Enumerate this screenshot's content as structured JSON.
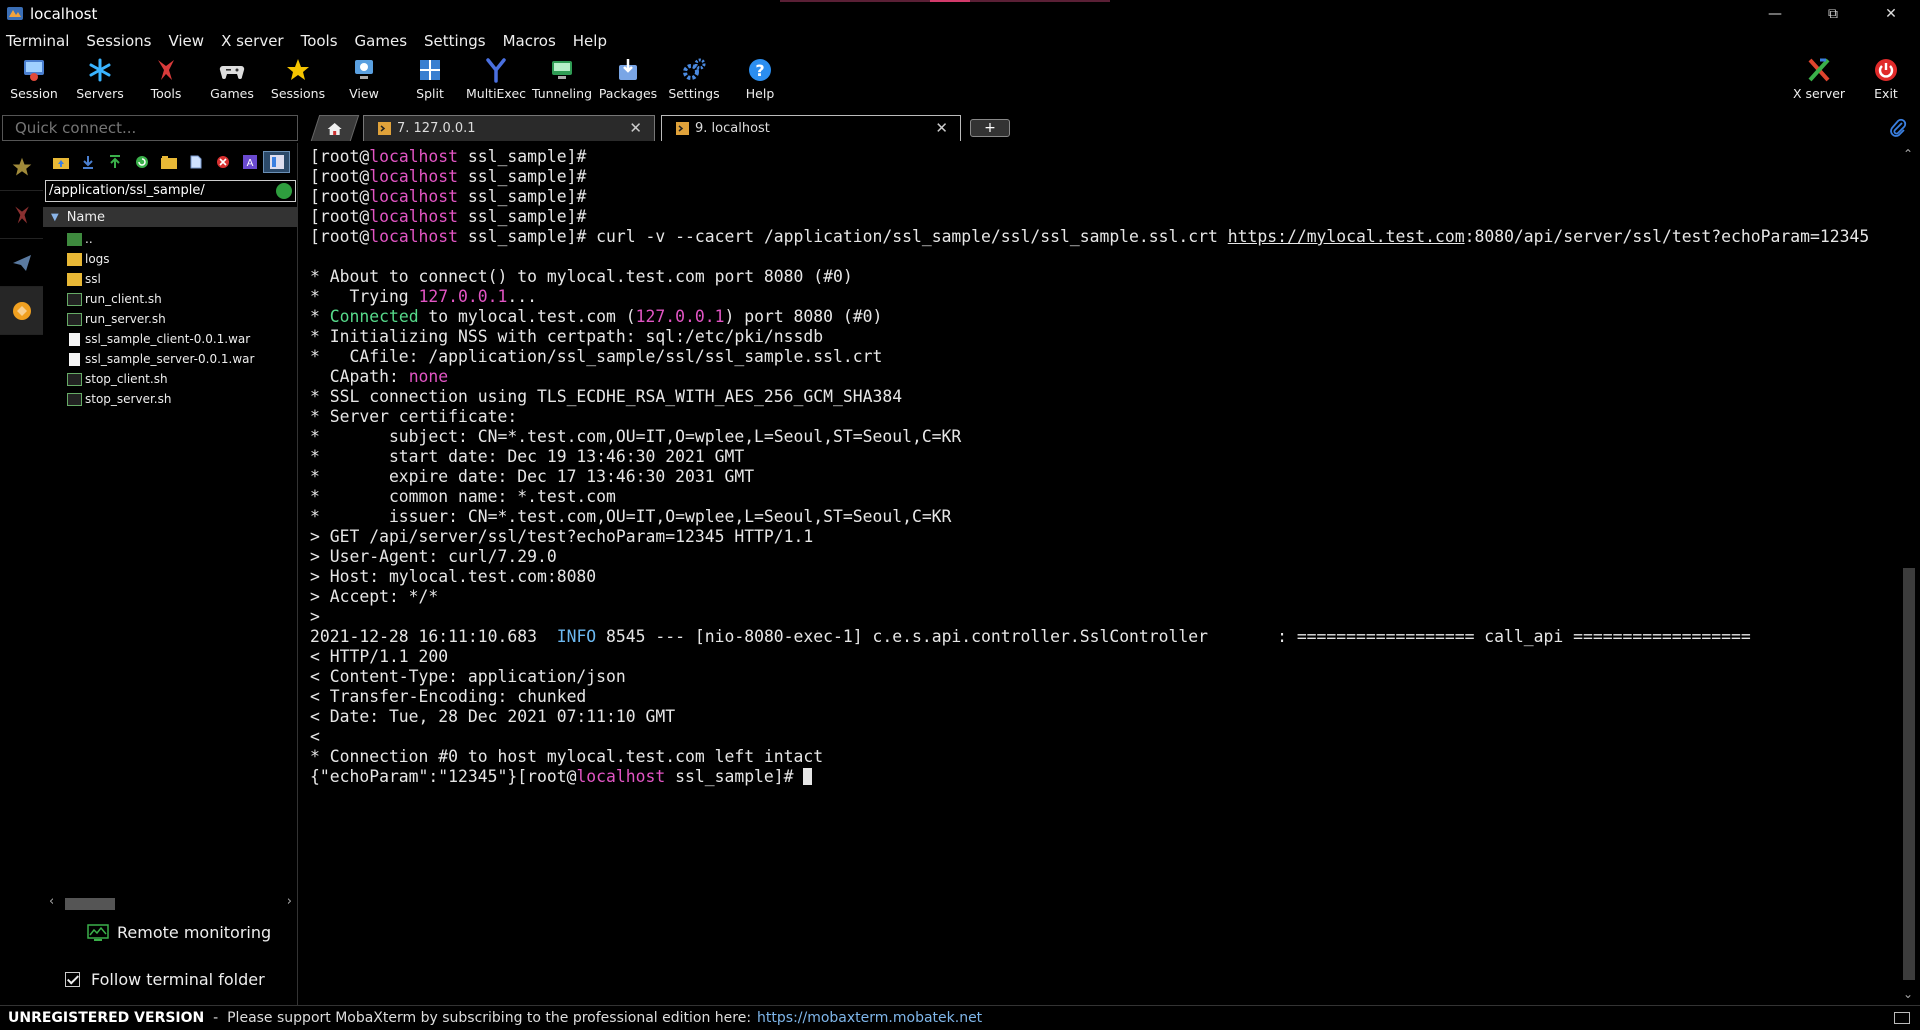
{
  "window": {
    "title": "localhost"
  },
  "menu": [
    "Terminal",
    "Sessions",
    "View",
    "X server",
    "Tools",
    "Games",
    "Settings",
    "Macros",
    "Help"
  ],
  "toolbar": {
    "buttons": [
      {
        "label": "Session",
        "icon": "session-icon"
      },
      {
        "label": "Servers",
        "icon": "servers-icon"
      },
      {
        "label": "Tools",
        "icon": "tools-icon"
      },
      {
        "label": "Games",
        "icon": "games-icon"
      },
      {
        "label": "Sessions",
        "icon": "star-icon"
      },
      {
        "label": "View",
        "icon": "view-icon"
      },
      {
        "label": "Split",
        "icon": "split-icon"
      },
      {
        "label": "MultiExec",
        "icon": "multiexec-icon"
      },
      {
        "label": "Tunneling",
        "icon": "tunneling-icon"
      },
      {
        "label": "Packages",
        "icon": "packages-icon"
      },
      {
        "label": "Settings",
        "icon": "settings-icon"
      },
      {
        "label": "Help",
        "icon": "help-icon"
      }
    ],
    "right_buttons": [
      {
        "label": "X server",
        "icon": "x-server-icon"
      },
      {
        "label": "Exit",
        "icon": "power-icon"
      }
    ]
  },
  "quick_connect": {
    "placeholder": "Quick connect..."
  },
  "tabs": [
    {
      "label": "7. 127.0.0.1",
      "active": false
    },
    {
      "label": "9. localhost",
      "active": true
    }
  ],
  "file_browser": {
    "path": "/application/ssl_sample/",
    "column_header": "Name",
    "items": [
      {
        "name": "..",
        "type": "parent"
      },
      {
        "name": "logs",
        "type": "folder"
      },
      {
        "name": "ssl",
        "type": "folder"
      },
      {
        "name": "run_client.sh",
        "type": "script"
      },
      {
        "name": "run_server.sh",
        "type": "script"
      },
      {
        "name": "ssl_sample_client-0.0.1.war",
        "type": "file"
      },
      {
        "name": "ssl_sample_server-0.0.1.war",
        "type": "file"
      },
      {
        "name": "stop_client.sh",
        "type": "script"
      },
      {
        "name": "stop_server.sh",
        "type": "script"
      }
    ],
    "remote_monitoring": "Remote monitoring",
    "follow_terminal_folder": "Follow terminal folder",
    "follow_checked": true
  },
  "terminal": {
    "lines": [
      [
        {
          "t": "[root@"
        },
        {
          "t": "localhost",
          "c": "host"
        },
        {
          "t": " ssl_sample]#"
        }
      ],
      [
        {
          "t": "[root@"
        },
        {
          "t": "localhost",
          "c": "host"
        },
        {
          "t": " ssl_sample]#"
        }
      ],
      [
        {
          "t": "[root@"
        },
        {
          "t": "localhost",
          "c": "host"
        },
        {
          "t": " ssl_sample]#"
        }
      ],
      [
        {
          "t": "[root@"
        },
        {
          "t": "localhost",
          "c": "host"
        },
        {
          "t": " ssl_sample]#"
        }
      ],
      [
        {
          "t": "[root@"
        },
        {
          "t": "localhost",
          "c": "host"
        },
        {
          "t": " ssl_sample]# curl -v --cacert /application/ssl_sample/ssl/ssl_sample.ssl.crt "
        },
        {
          "t": "https://mylocal.test.com",
          "c": "url"
        },
        {
          "t": ":8080/api/server/ssl/test?echoParam=12345"
        }
      ],
      [
        {
          "t": ""
        }
      ],
      [
        {
          "t": "* About to connect() to mylocal.test.com port 8080 (#0)"
        }
      ],
      [
        {
          "t": "*   Trying "
        },
        {
          "t": "127.0.0.1",
          "c": "ip"
        },
        {
          "t": "..."
        }
      ],
      [
        {
          "t": "* "
        },
        {
          "t": "Connected",
          "c": "ok"
        },
        {
          "t": " to mylocal.test.com ("
        },
        {
          "t": "127.0.0.1",
          "c": "ip"
        },
        {
          "t": ") port 8080 (#0)"
        }
      ],
      [
        {
          "t": "* Initializing NSS with certpath: sql:/etc/pki/nssdb"
        }
      ],
      [
        {
          "t": "*   CAfile: /application/ssl_sample/ssl/ssl_sample.ssl.crt"
        }
      ],
      [
        {
          "t": "  CApath: "
        },
        {
          "t": "none",
          "c": "none"
        }
      ],
      [
        {
          "t": "* SSL connection using TLS_ECDHE_RSA_WITH_AES_256_GCM_SHA384"
        }
      ],
      [
        {
          "t": "* Server certificate:"
        }
      ],
      [
        {
          "t": "*       subject: CN=*.test.com,OU=IT,O=wplee,L=Seoul,ST=Seoul,C=KR"
        }
      ],
      [
        {
          "t": "*       start date: Dec 19 13:46:30 2021 GMT"
        }
      ],
      [
        {
          "t": "*       expire date: Dec 17 13:46:30 2031 GMT"
        }
      ],
      [
        {
          "t": "*       common name: *.test.com"
        }
      ],
      [
        {
          "t": "*       issuer: CN=*.test.com,OU=IT,O=wplee,L=Seoul,ST=Seoul,C=KR"
        }
      ],
      [
        {
          "t": "> GET /api/server/ssl/test?echoParam=12345 HTTP/1.1"
        }
      ],
      [
        {
          "t": "> User-Agent: curl/7.29.0"
        }
      ],
      [
        {
          "t": "> Host: mylocal.test.com:8080"
        }
      ],
      [
        {
          "t": "> Accept: */*"
        }
      ],
      [
        {
          "t": ">"
        }
      ],
      [
        {
          "t": "2021-12-28 16:11:10.683  "
        },
        {
          "t": "INFO",
          "c": "info"
        },
        {
          "t": " 8545 --- [nio-8080-exec-1] c.e.s.api.controller.SslController       : ================== call_api =================="
        }
      ],
      [
        {
          "t": "< HTTP/1.1 200"
        }
      ],
      [
        {
          "t": "< Content-Type: application/json"
        }
      ],
      [
        {
          "t": "< Transfer-Encoding: chunked"
        }
      ],
      [
        {
          "t": "< Date: Tue, 28 Dec 2021 07:11:10 GMT"
        }
      ],
      [
        {
          "t": "<"
        }
      ],
      [
        {
          "t": "* Connection #0 to host mylocal.test.com left intact"
        }
      ],
      [
        {
          "t": "{\"echoParam\":\"12345\"}[root@"
        },
        {
          "t": "localhost",
          "c": "host"
        },
        {
          "t": " ssl_sample]# "
        },
        {
          "t": "",
          "c": "cursor"
        }
      ]
    ]
  },
  "status_bar": {
    "unregistered": "UNREGISTERED VERSION",
    "message": "  -  Please support MobaXterm by subscribing to the professional edition here:",
    "link": "https://mobaxterm.mobatek.net"
  },
  "colors": {
    "host": "#e255c4",
    "connected": "#56d98a",
    "info": "#6cb8f0",
    "link": "#7fb6ea"
  }
}
